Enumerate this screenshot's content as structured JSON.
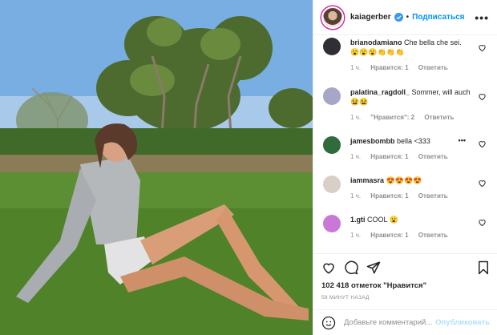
{
  "post": {
    "username": "kaiagerber",
    "follow_label": "Подписаться",
    "separator": "•",
    "more_label": "•••",
    "likes": "102 418 отметок \"Нравится\"",
    "time_ago": "59 МИНУТ НАЗАД",
    "comment_placeholder": "Добавьте комментарий...",
    "publish_label": "Опубликовать"
  },
  "comments": [
    {
      "user": "brianodamiano",
      "text": "Che bella che sei.",
      "emoji": "😮😮😮👏👏👏",
      "time": "1 ч.",
      "likes": "Нравится: 1",
      "reply": "Ответить",
      "avatar_color": "#2f2f36"
    },
    {
      "user": "palatina_ragdoll_",
      "text": "Sommer, will auch😫😫",
      "emoji": "",
      "time": "1 ч.",
      "likes": "\"Нравится\": 2",
      "reply": "Ответить",
      "avatar_color": "#a8a6c8"
    },
    {
      "user": "jamesbombb",
      "text": "bella <333",
      "emoji": "",
      "time": "1 ч.",
      "likes": "Нравится: 1",
      "reply": "Ответить",
      "avatar_color": "#2f6b3d"
    },
    {
      "user": "iammasra",
      "text": "😍😍😍😍",
      "emoji": "",
      "time": "1 ч.",
      "likes": "Нравится: 1",
      "reply": "Ответить",
      "avatar_color": "#d8d0c6"
    },
    {
      "user": "1.gti",
      "text": "COOL 😮",
      "emoji": "",
      "time": "1 ч.",
      "likes": "Нравится: 1",
      "reply": "Ответить",
      "avatar_color": "#c978d8"
    }
  ],
  "colors": {
    "accent": "#0095f6",
    "muted": "#8e8e8e",
    "publish_disabled": "#b2dffc"
  }
}
